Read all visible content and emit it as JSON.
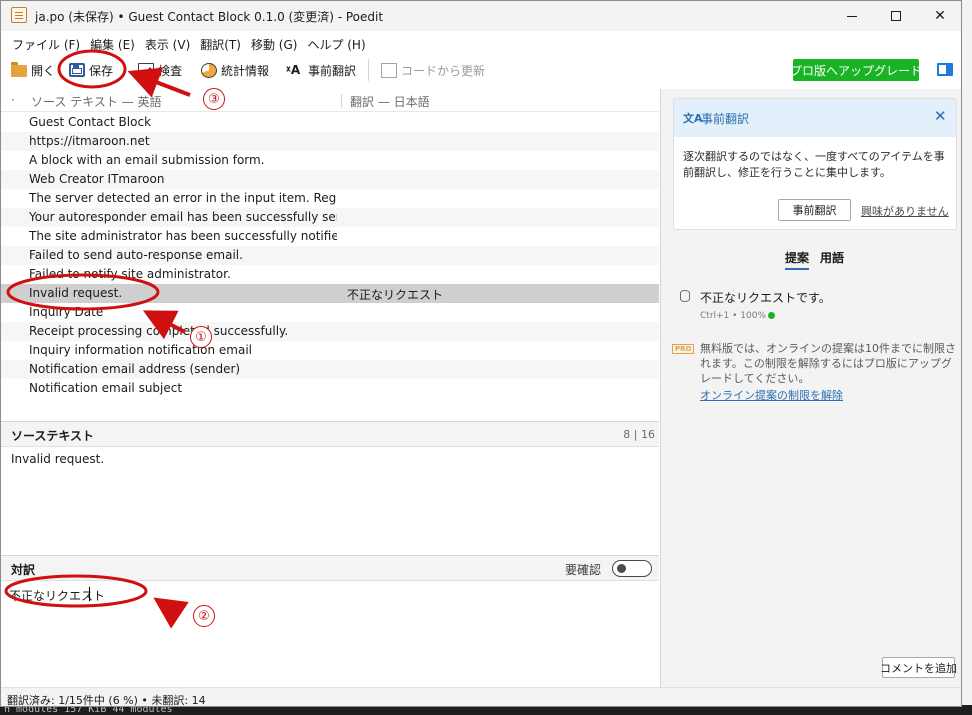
{
  "window": {
    "title": "ja.po (未保存) • Guest Contact Block 0.1.0 (変更済) - Poedit"
  },
  "menu": [
    "ファイル (F)",
    "編集 (E)",
    "表示 (V)",
    "翻訳(T)",
    "移動 (G)",
    "ヘルプ (H)"
  ],
  "toolbar": {
    "open": "開く",
    "save": "保存",
    "validate": "検査",
    "stats": "統計情報",
    "pretranslate": "事前翻訳",
    "update_from_code": "コードから更新",
    "upgrade": "プロ版へアップグレード"
  },
  "list": {
    "header_source": "ソース テキスト — 英語",
    "header_translation": "翻訳 — 日本語",
    "rows": [
      {
        "source": "Guest Contact Block",
        "translation": ""
      },
      {
        "source": "https://itmaroon.net",
        "translation": ""
      },
      {
        "source": "A block with an email submission form.",
        "translation": ""
      },
      {
        "source": "Web Creator ITmaroon",
        "translation": ""
      },
      {
        "source": "The server detected an error in the input item. Registratio...",
        "translation": ""
      },
      {
        "source": "Your autoresponder email has been successfully sent.",
        "translation": ""
      },
      {
        "source": "The site administrator has been successfully notified.",
        "translation": ""
      },
      {
        "source": "Failed to send auto-response email.",
        "translation": ""
      },
      {
        "source": "Failed to notify site administrator.",
        "translation": ""
      },
      {
        "source": "Invalid request.",
        "translation": "不正なリクエスト"
      },
      {
        "source": "Inquiry Date",
        "translation": ""
      },
      {
        "source": "Receipt processing completed successfully.",
        "translation": ""
      },
      {
        "source": "Inquiry information notification email",
        "translation": ""
      },
      {
        "source": "Notification email address (sender)",
        "translation": ""
      },
      {
        "source": "Notification email subject",
        "translation": ""
      }
    ],
    "selected_index": 9
  },
  "source_panel": {
    "label": "ソーステキスト",
    "count": "8 | 16",
    "text": "Invalid request."
  },
  "translation_panel": {
    "label": "対訳",
    "fuzzy_label": "要確認",
    "fuzzy": false,
    "value": "不正なリクエスト"
  },
  "status": "翻訳済み: 1/15件中 (6 %) • 未翻訳: 14",
  "sidebar": {
    "pretranslate_card": {
      "icon": "文A",
      "title": "事前翻訳",
      "body": "逐次翻訳するのではなく、一度すべてのアイテムを事前翻訳し、修正を行うことに集中します。",
      "button": "事前翻訳",
      "dismiss": "興味がありません"
    },
    "tabs": [
      "提案",
      "用語"
    ],
    "suggestion": {
      "text": "不正なリクエストです。",
      "meta": "Ctrl+1 • 100%"
    },
    "pro_note": {
      "badge": "PRO",
      "text": "無料版では、オンラインの提案は10件までに制限されます。この制限を解除するにはプロ版にアップグレードしてください。",
      "link": "オンライン提案の制限を解除"
    },
    "add_comment": "コメントを追加"
  },
  "background": {
    "terminal_text": "n modules 157 KiB 44 modules"
  },
  "annotations": [
    "①",
    "②",
    "③"
  ],
  "colors": {
    "upgrade_button": "#19b326",
    "annotation": "#d01010",
    "accent": "#2a6fb0"
  }
}
